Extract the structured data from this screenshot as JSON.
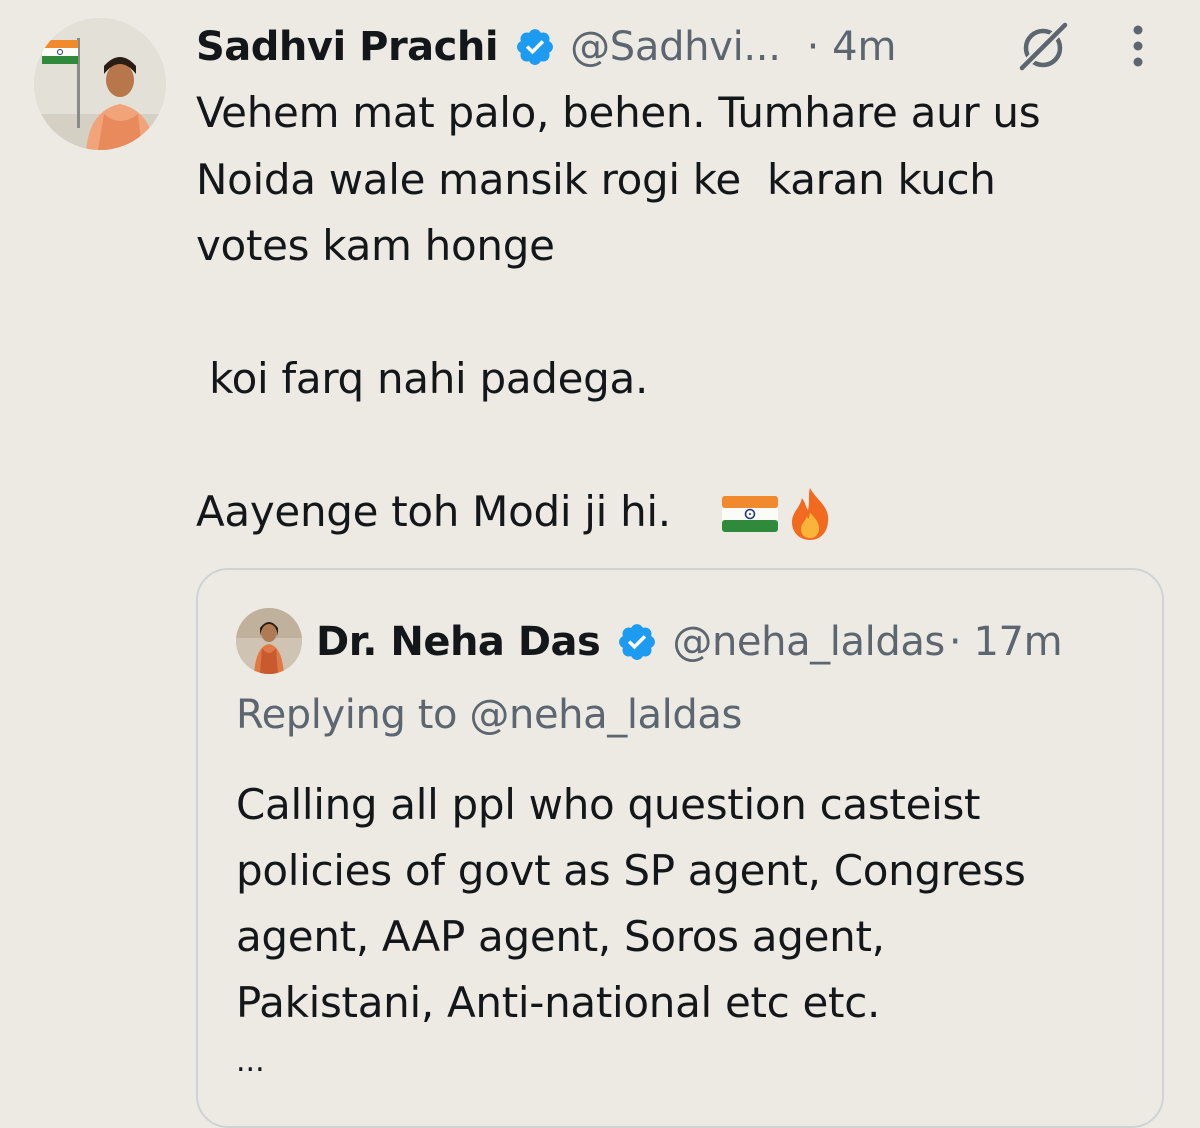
{
  "tweet": {
    "author": {
      "display_name": "Sadhvi Prachi",
      "handle": "@Sadhvi...",
      "verified": true,
      "avatar": "profile-photo"
    },
    "time": "· 4m",
    "text": "Vehem mat palo, behen. Tumhare aur us\nNoida wale mansik rogi ke  karan kuch\nvotes kam honge\n\n koi farq nahi padega.\n\nAayenge toh Modi ji hi.",
    "emojis": [
      "india-flag",
      "fire"
    ],
    "icons": {
      "grok": "grok-icon",
      "more": "more-vertical-icon"
    }
  },
  "quoted_tweet": {
    "author": {
      "display_name": "Dr. Neha Das",
      "handle": "@neha_laldas",
      "verified": true,
      "avatar": "profile-photo"
    },
    "time": "· 17m",
    "replying_to": "Replying to @neha_laldas",
    "text": "Calling all ppl who question casteist\npolicies of govt as SP agent, Congress\nagent, AAP agent, Soros agent,\nPakistani, Anti-national etc etc.",
    "truncation": "..."
  },
  "colors": {
    "background": "#edeae4",
    "text_primary": "#14171a",
    "text_secondary": "#5b6670",
    "verified_blue": "#1d9bf0",
    "card_border": "#cfd3d6"
  }
}
